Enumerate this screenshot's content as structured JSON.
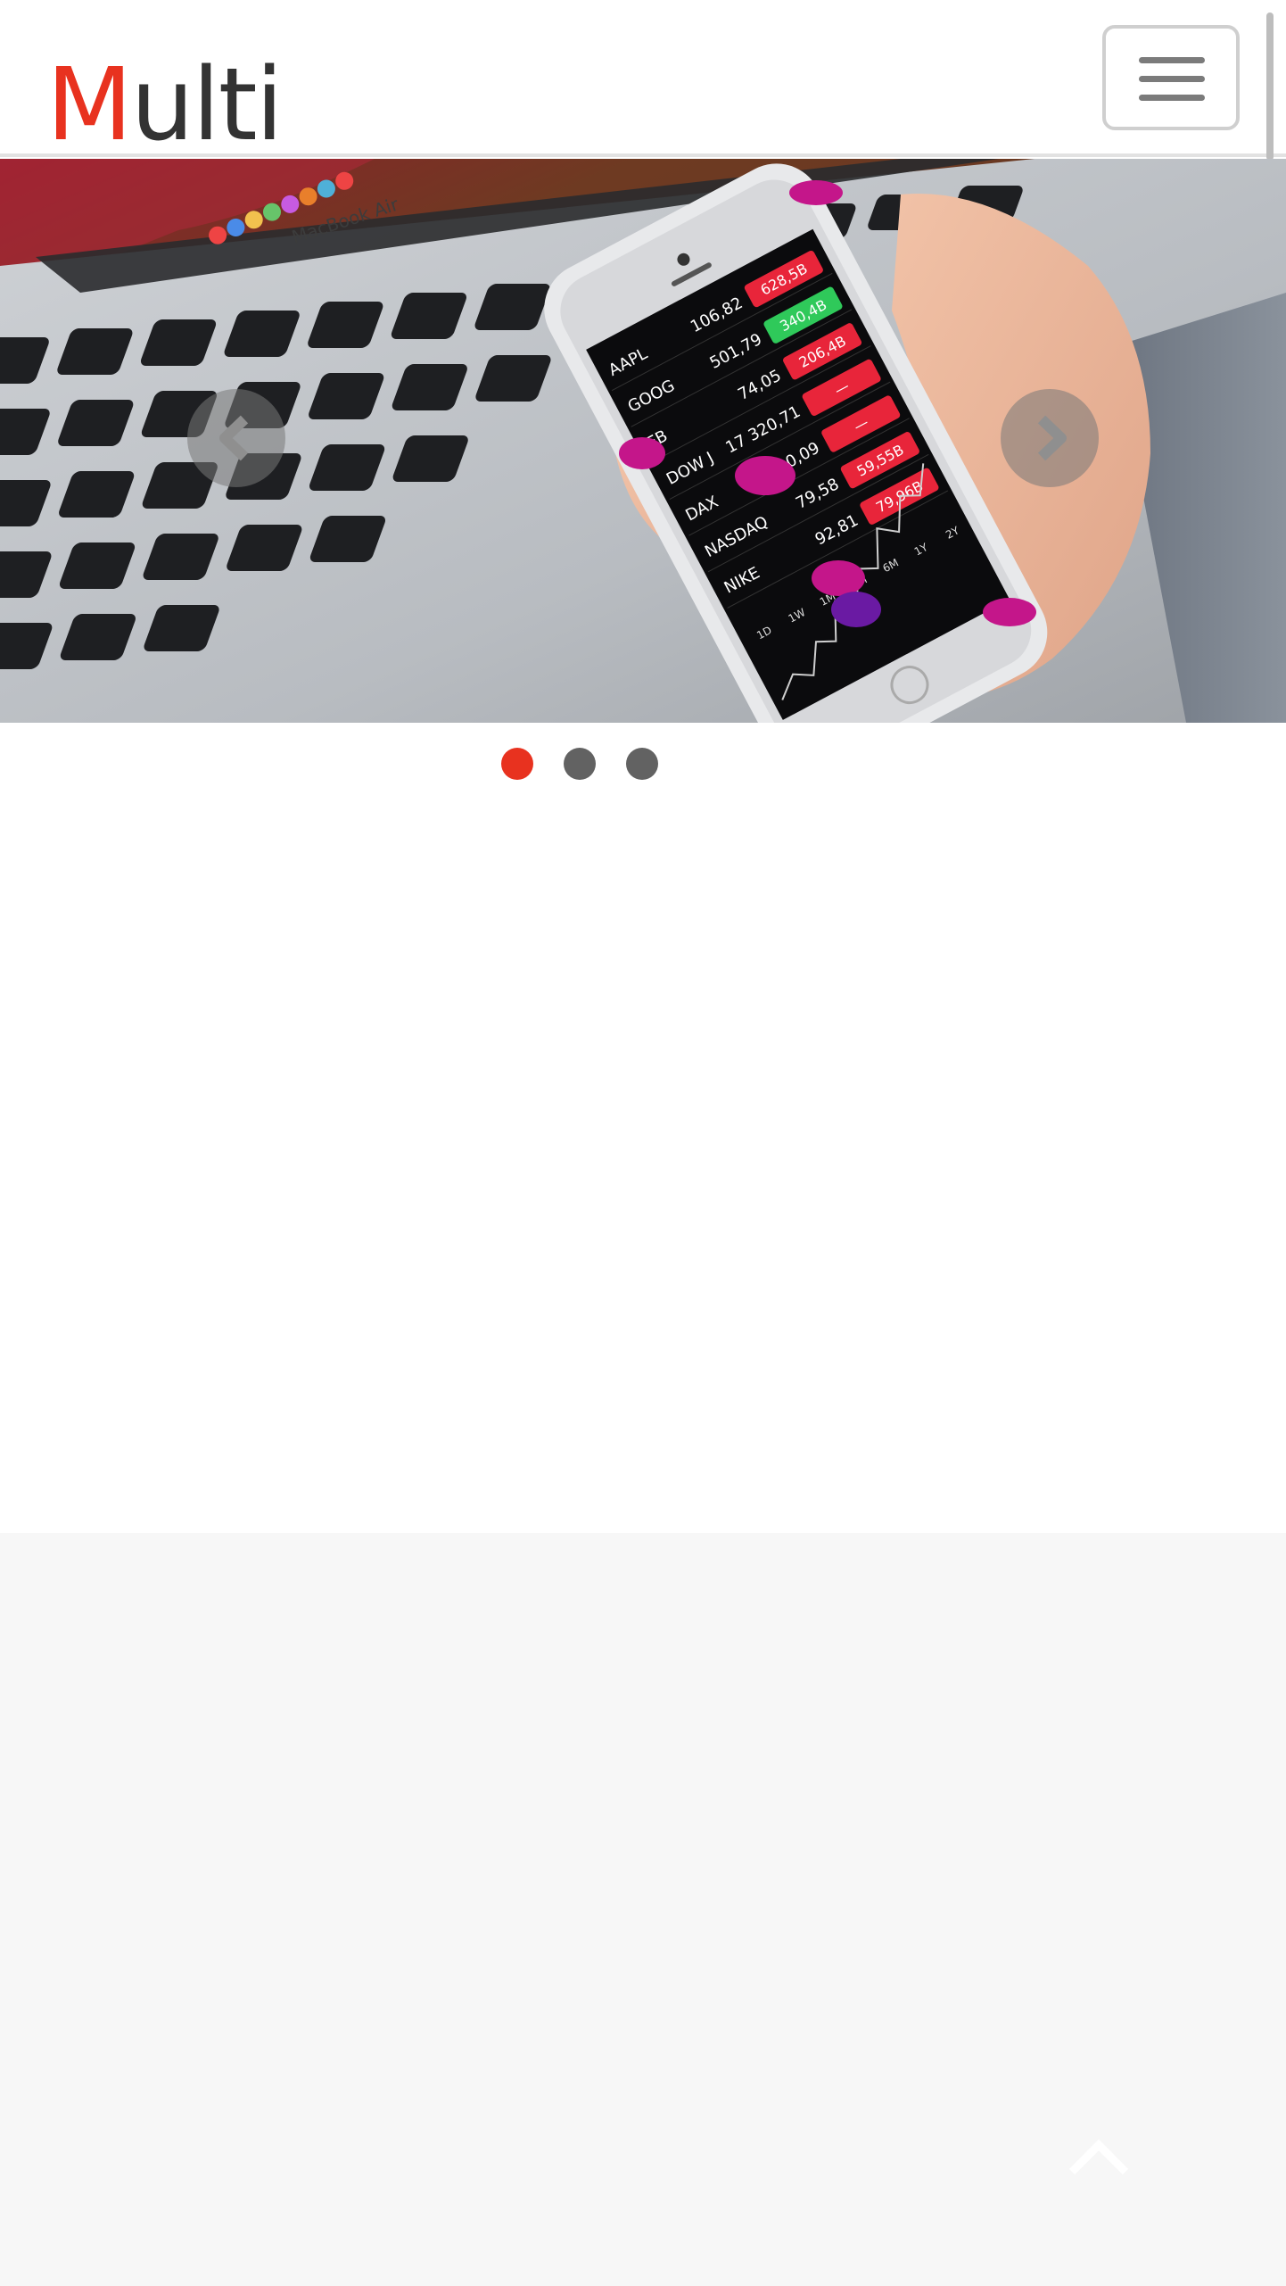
{
  "brand": {
    "first_letter": "M",
    "rest": "ulti"
  },
  "header": {
    "menu_icon": "hamburger-icon"
  },
  "carousel": {
    "prev_icon": "chevron-left-icon",
    "next_icon": "chevron-right-icon",
    "active_index": 0,
    "slide_count": 3,
    "active_color": "#e8321f",
    "inactive_color": "#626262",
    "slide_image": {
      "laptop_label": "MacBook Air",
      "stocks": [
        {
          "symbol": "AAPL",
          "price": "106,82",
          "change": "628,5B",
          "change_color": "#e8253a"
        },
        {
          "symbol": "GOOG",
          "price": "501,79",
          "change": "340,4B",
          "change_color": "#2fc95a"
        },
        {
          "symbol": "FB",
          "price": "74,05",
          "change": "206,4B",
          "change_color": "#e8253a"
        },
        {
          "symbol": "DOW J",
          "price": "17 320,71",
          "change": "—",
          "change_color": "#e8253a"
        },
        {
          "symbol": "DAX",
          "price": "9 990,09",
          "change": "—",
          "change_color": "#e8253a"
        },
        {
          "symbol": "NASDAQ",
          "price": "79,58",
          "change": "59,55B",
          "change_color": "#e8253a"
        },
        {
          "symbol": "NIKE",
          "price": "92,81",
          "change": "79,96B",
          "change_color": "#e8253a"
        }
      ],
      "ranges": [
        "1D",
        "1W",
        "1M",
        "3M",
        "6M",
        "1Y",
        "2Y"
      ]
    }
  },
  "footer": {
    "scroll_top_icon": "chevron-up-icon"
  },
  "colors": {
    "accent": "#e8321f",
    "text": "#333333",
    "section_bg": "#f7f7f7"
  }
}
